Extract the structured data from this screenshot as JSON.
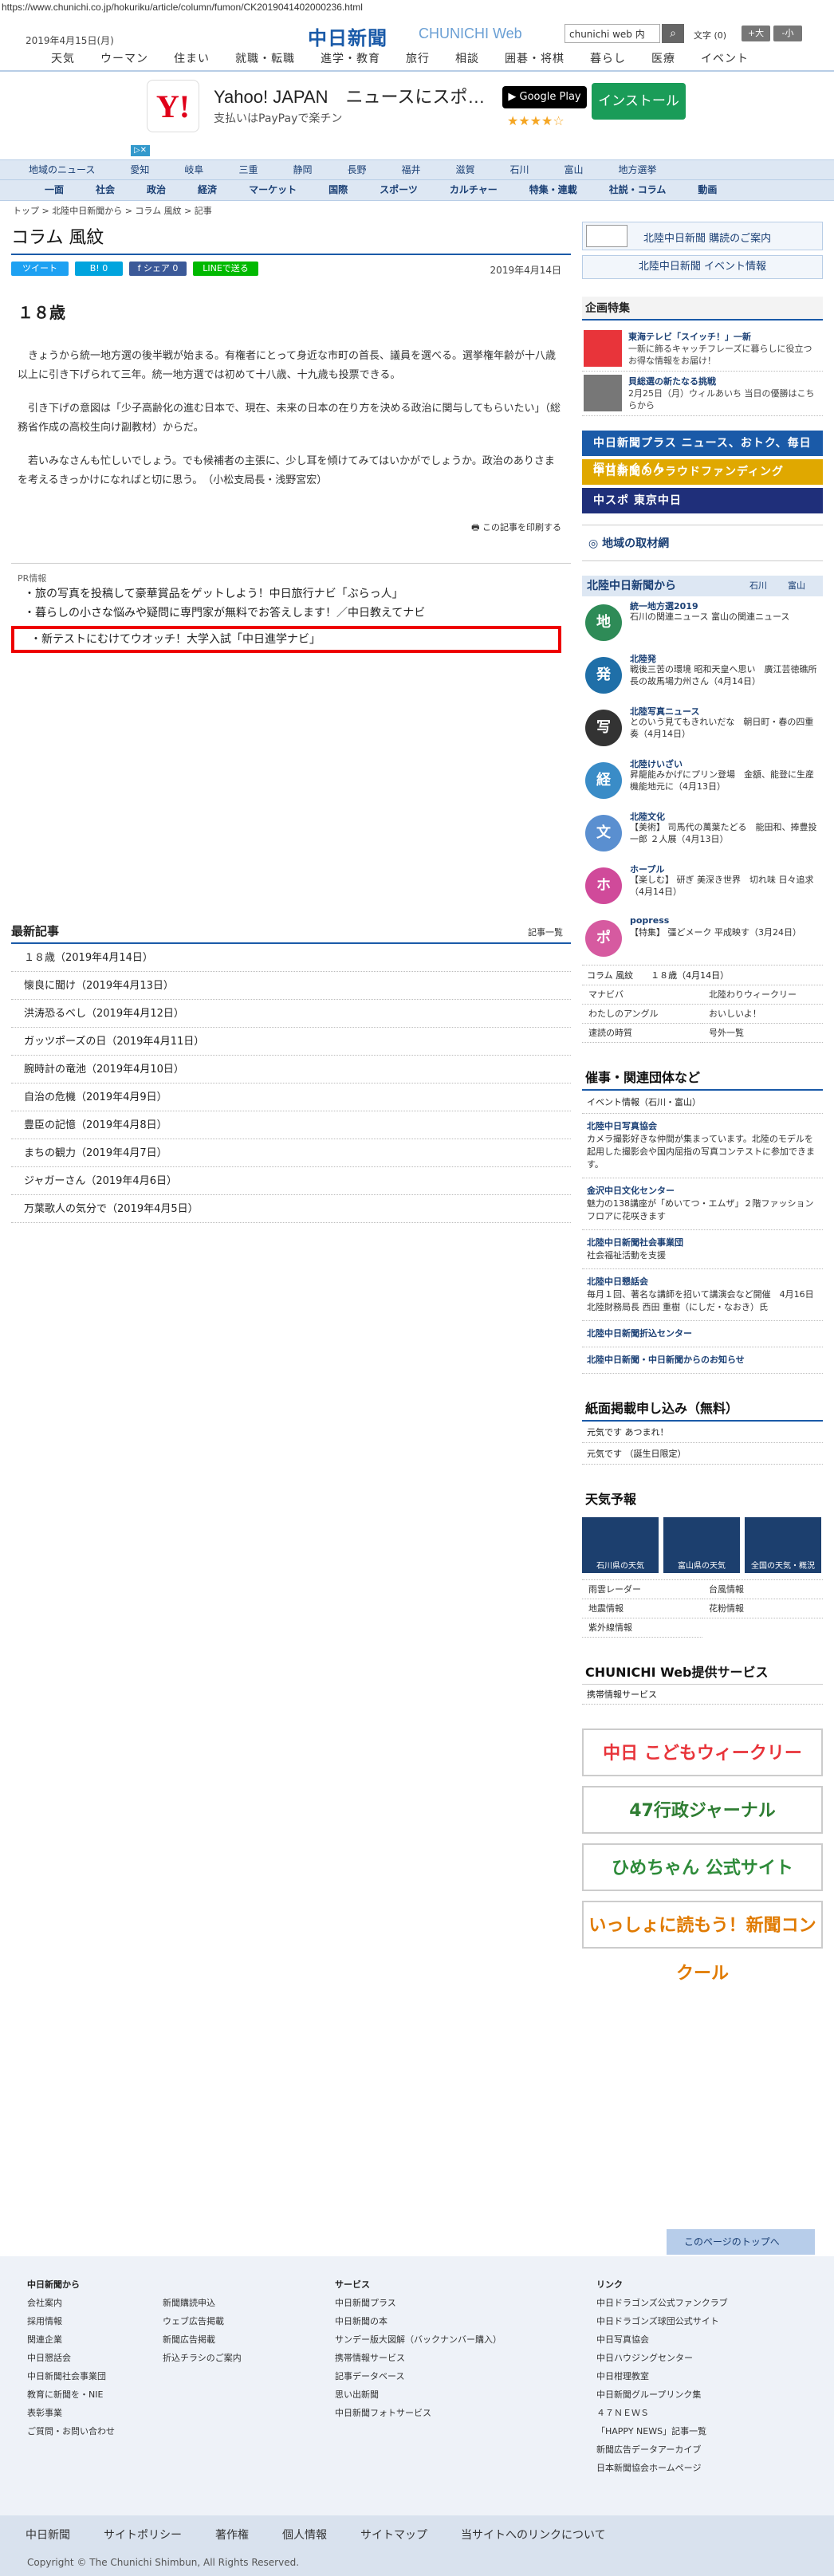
{
  "url": "https://www.chunichi.co.jp/hokuriku/article/column/fumon/CK2019041402000236.html",
  "header": {
    "date": "2019年4月15日(月)",
    "logo_jp": "中日新聞",
    "logo_en": "CHUNICHI Web",
    "search_value": "chunichi web 内",
    "font_label": "文字 (0)",
    "font_bigger": "+大",
    "font_smaller": "-小"
  },
  "global_nav": [
    "天気",
    "ウーマン",
    "住まい",
    "就職・転職",
    "進学・教育",
    "旅行",
    "相談",
    "囲碁・将棋",
    "暮らし",
    "医療",
    "イベント"
  ],
  "ad": {
    "brand": "Y!",
    "title": "Yahoo! JAPAN　ニュースにスポ…",
    "subtitle": "支払いはPayPayで楽チン",
    "store": "▶ Google Play",
    "stars": "★★★★☆",
    "install": "インストール"
  },
  "region_nav": [
    "地域のニュース",
    "愛知",
    "岐阜",
    "三重",
    "静岡",
    "長野",
    "福井",
    "滋賀",
    "石川",
    "富山",
    "地方選挙"
  ],
  "category_nav": [
    "一面",
    "社会",
    "政治",
    "経済",
    "マーケット",
    "国際",
    "スポーツ",
    "カルチャー",
    "特集・連載",
    "社説・コラム",
    "動画"
  ],
  "breadcrumb": "トップ > 北陸中日新聞から > コラム 風紋 > 記事",
  "page_title": "コラム 風紋",
  "share": {
    "tweet": "ツイート",
    "hatena": "B! 0",
    "facebook": "f シェア 0",
    "line": "LINEで送る"
  },
  "publish_date": "2019年4月14日",
  "article": {
    "title": "１８歳",
    "paragraphs": [
      "きょうから統一地方選の後半戦が始まる。有権者にとって身近な市町の首長、議員を選べる。選挙権年齢が十八歳以上に引き下げられて三年。統一地方選では初めて十八歳、十九歳も投票できる。",
      "引き下げの意図は「少子高齢化の進む日本で、現在、未来の日本の在り方を決める政治に関与してもらいたい」（総務省作成の高校生向け副教材）からだ。",
      "若いみなさんも忙しいでしょう。でも候補者の主張に、少し耳を傾けてみてはいかがでしょうか。政治のありさまを考えるきっかけになればと切に思う。　（小松支局長・浅野宮宏）"
    ]
  },
  "print_label": "この記事を印刷する",
  "pr": {
    "heading": "PR情報",
    "items": [
      "旅の写真を投稿して豪華賞品をゲットしよう！中日旅行ナビ「ぶらっ人」",
      "暮らしの小さな悩みや疑問に専門家が無料でお答えします！／中日教えてナビ",
      "新テストにむけてウオッチ！大学入試「中日進学ナビ」"
    ]
  },
  "latest": {
    "heading": "最新記事",
    "more": "記事一覧",
    "items": [
      "１８歳（2019年4月14日）",
      "懐良に聞け（2019年4月13日）",
      "洪涛恐るべし（2019年4月12日）",
      "ガッツポーズの日（2019年4月11日）",
      "腕時計の竜池（2019年4月10日）",
      "自治の危機（2019年4月9日）",
      "豊臣の記憶（2019年4月8日）",
      "まちの観力（2019年4月7日）",
      "ジャガーさん（2019年4月6日）",
      "万葉歌人の気分で（2019年4月5日）"
    ]
  },
  "sidebar": {
    "subscribe": "北陸中日新聞 購読のご案内",
    "events": "北陸中日新聞 イベント情報",
    "feature_heading": "企画特集",
    "features": [
      {
        "title": "東海テレビ「スイッチ！」一新",
        "desc": "一新に飾るキャッチフレーズに暮らしに役立つ お得な情報をお届け！"
      },
      {
        "title": "貝総選の新たなる挑戦",
        "desc": "2月25日（月）ウィルあいち\n当日の優勝はこちらから"
      }
    ],
    "banners": [
      {
        "text": "中日新聞プラス ニュース、おトク、毎日探せもぐくん",
        "color": "#1a5aa8"
      },
      {
        "text": "中日新聞のクラウドファンディング",
        "color": "#e0a800"
      },
      {
        "text": "中スポ 東京中日",
        "color": "#1f2f7a"
      }
    ],
    "local_interview": "地域の取材網",
    "from_heading": "北陸中日新聞から",
    "from_tabs": [
      "石川",
      "富山"
    ],
    "sections": [
      {
        "icon": "地",
        "color": "#2e8b57",
        "title": "統一地方選2019",
        "desc": "石川の関連ニュース\n富山の関連ニュース"
      },
      {
        "icon": "発",
        "color": "#1f6fa8",
        "title": "北陸発",
        "desc": "戦後三苦の環境 昭和天皇へ思い　廣江芸徳礁所長の故馬場力州さん（4月14日）"
      },
      {
        "icon": "写",
        "color": "#333333",
        "title": "北陸写真ニュース",
        "desc": "とのいう見てもきれいだな　朝日町・春の四重奏（4月14日）"
      },
      {
        "icon": "経",
        "color": "#3a8cc7",
        "title": "北陸けいざい",
        "desc": "昇龍能みかげにプリン登場　金額、能登に生産機能地元に（4月13日）"
      },
      {
        "icon": "文",
        "color": "#5a8fd0",
        "title": "北陸文化",
        "desc": "【美術】 司馬代の萬葉たどる　能田和、捧豊投一郎 ２人展（4月13日）"
      },
      {
        "icon": "ホ",
        "color": "#d04a9a",
        "title": "ホープル",
        "desc": "【楽しむ】 研ぎ 美深き世界　切れ味 日々追求（4月14日）"
      },
      {
        "icon": "ポ",
        "color": "#d65aa0",
        "title": "popress",
        "desc": "【特集】 彊どメーク 平成映す（3月24日）"
      }
    ],
    "column_row": "コラム 風紋　　１８歳（4月14日）",
    "links": [
      "マナビバ",
      "北陸わりウィークリー",
      "わたしのアングル",
      "おいしいよ！",
      "速読の時質",
      "号外一覧"
    ],
    "org_heading": "催事・関連団体など",
    "event_info": "イベント情報（石川・富山）",
    "orgs": [
      {
        "title": "北陸中日写真協会",
        "desc": "カメラ撮影好きな仲間が集まっています。北陸のモデルを起用した撮影会や国内屈指の写真コンテストに参加できます。"
      },
      {
        "title": "金沢中日文化センター",
        "desc": "魅力の138講座が「めいてつ・エムザ」２階ファッションフロアに花咲きます"
      },
      {
        "title": "北陸中日新聞社会事業団",
        "desc": "社会福祉活動を支援"
      },
      {
        "title": "北陸中日懇話会",
        "desc": "毎月１回、著名な講師を招いて講演会など開催　4月16日 北陸財務局長 西田 重樹（にしだ・なおき）氏"
      },
      {
        "title": "北陸中日新聞折込センター",
        "desc": ""
      },
      {
        "title": "北陸中日新聞・中日新聞からのお知らせ",
        "desc": ""
      }
    ],
    "free_heading": "紙面掲載申し込み（無料）",
    "free_items": [
      "元気です あつまれ！",
      "元気です （誕生日限定）"
    ],
    "weather_heading": "天気予報",
    "weather": [
      "石川県の天気",
      "富山県の天気",
      "全国の天気・概況"
    ],
    "weather_links": [
      "雨雲レーダー",
      "台風情報",
      "地震情報",
      "花粉情報",
      "紫外線情報"
    ],
    "services_heading": "CHUNICHI Web提供サービス",
    "services": [
      "携帯情報サービス"
    ],
    "big_banners": [
      {
        "text": "中日 こどもウィークリー",
        "color": "#e8343a"
      },
      {
        "text": "47行政ジャーナル",
        "color": "#2e7d32"
      },
      {
        "text": "ひめちゃん 公式サイト",
        "color": "#2e8b3a"
      },
      {
        "text": "いっしょに読もう！新聞コンクール",
        "color": "#e07a00"
      }
    ]
  },
  "to_top": "このページのトップへ",
  "footer": {
    "col1_title": "中日新聞から",
    "col1": [
      "会社案内",
      "採用情報",
      "関連企業",
      "中日懇話会",
      "中日新聞社会事業団",
      "教育に新聞を・NIE",
      "表彰事業",
      "ご質問・お問い合わせ"
    ],
    "col2": [
      "新聞購読申込",
      "ウェブ広告掲載",
      "新聞広告掲載",
      "折込チラシのご案内"
    ],
    "col3_title": "サービス",
    "col3": [
      "中日新聞プラス",
      "中日新聞の本",
      "サンデー版大図解（バックナンバー購入）",
      "携帯情報サービス",
      "記事データベース",
      "思い出新聞",
      "中日新聞フォトサービス"
    ],
    "col4_title": "リンク",
    "col4": [
      "中日ドラゴンズ公式ファンクラブ",
      "中日ドラゴンズ球団公式サイト",
      "中日写真協会",
      "中日ハウジングセンター",
      "中日柑理教室",
      "中日新聞グループリンク集",
      "４７ＮＥＷＳ",
      "「HAPPY NEWS」記事一覧",
      "新聞広告データアーカイブ",
      "日本新聞協会ホームページ"
    ]
  },
  "footbar": {
    "links": [
      "中日新聞",
      "サイトポリシー",
      "著作権",
      "個人情報",
      "サイトマップ",
      "当サイトへのリンクについて"
    ],
    "copyright": "Copyright © The Chunichi Shimbun, All Rights Reserved."
  }
}
